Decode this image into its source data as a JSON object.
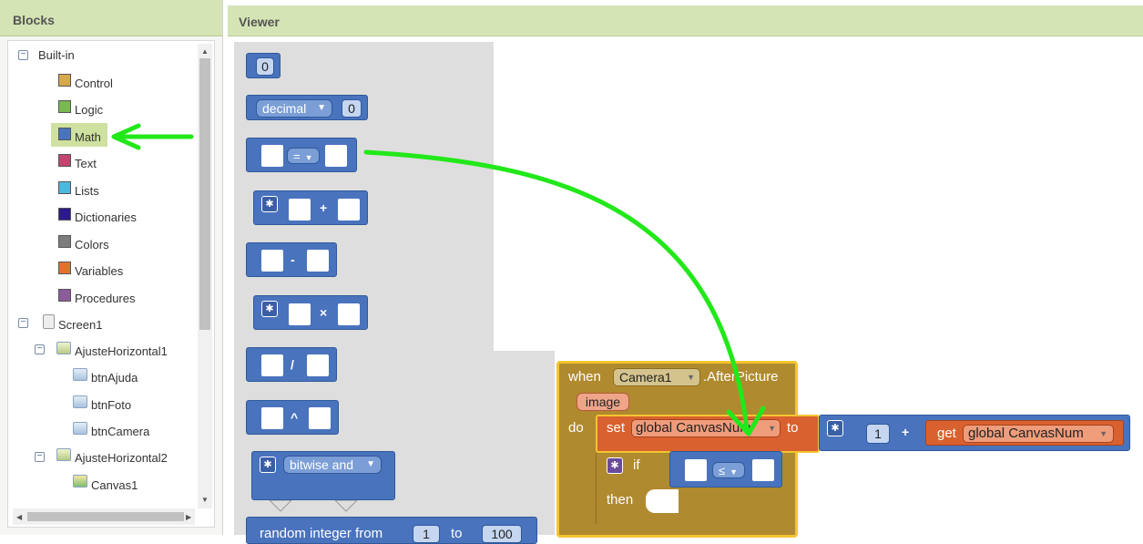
{
  "blocks_panel": {
    "title": "Blocks",
    "builtin": "Built-in",
    "categories": [
      {
        "label": "Control",
        "color": "#d6a94a"
      },
      {
        "label": "Logic",
        "color": "#7ab852"
      },
      {
        "label": "Math",
        "color": "#4a73bd"
      },
      {
        "label": "Text",
        "color": "#c24470"
      },
      {
        "label": "Lists",
        "color": "#4fb7dd"
      },
      {
        "label": "Dictionaries",
        "color": "#2d1a8a"
      },
      {
        "label": "Colors",
        "color": "#7d7d7d"
      },
      {
        "label": "Variables",
        "color": "#e0722f"
      },
      {
        "label": "Procedures",
        "color": "#8a5c9b"
      }
    ],
    "components": {
      "screen": "Screen1",
      "arrangements": [
        {
          "name": "AjusteHorizontal1",
          "children": [
            "btnAjuda",
            "btnFoto",
            "btnCamera"
          ]
        },
        {
          "name": "AjusteHorizontal2",
          "children": [
            "Canvas1"
          ]
        }
      ]
    }
  },
  "viewer": {
    "title": "Viewer",
    "drawer_blocks": {
      "number_value": "0",
      "decimal_label": "decimal",
      "decimal_value": "0",
      "eq_op": "=",
      "plus_op": "+",
      "minus_op": "-",
      "times_op": "×",
      "divide_op": "/",
      "power_op": "^",
      "bitwise_label": "bitwise and",
      "random_label": "random integer from",
      "random_from": "1",
      "random_to_label": "to",
      "random_to": "100"
    },
    "event_block": {
      "when": "when",
      "component": "Camera1",
      "event": ".AfterPicture",
      "param": "image",
      "do": "do",
      "set": "set",
      "var_name": "global CanvasNum",
      "to": "to",
      "add_value": "1",
      "plus": "+",
      "get": "get",
      "get_var": "global CanvasNum",
      "if": "if",
      "then": "then",
      "compare_op": "≤"
    }
  },
  "colors": {
    "header_green": "#d4e4b4",
    "math_blue": "#4a73bd",
    "event_brown": "#b08a2e",
    "variable_orange": "#d9612f",
    "highlight_yellow": "#f4c530",
    "annotation_green": "#22e81a"
  }
}
